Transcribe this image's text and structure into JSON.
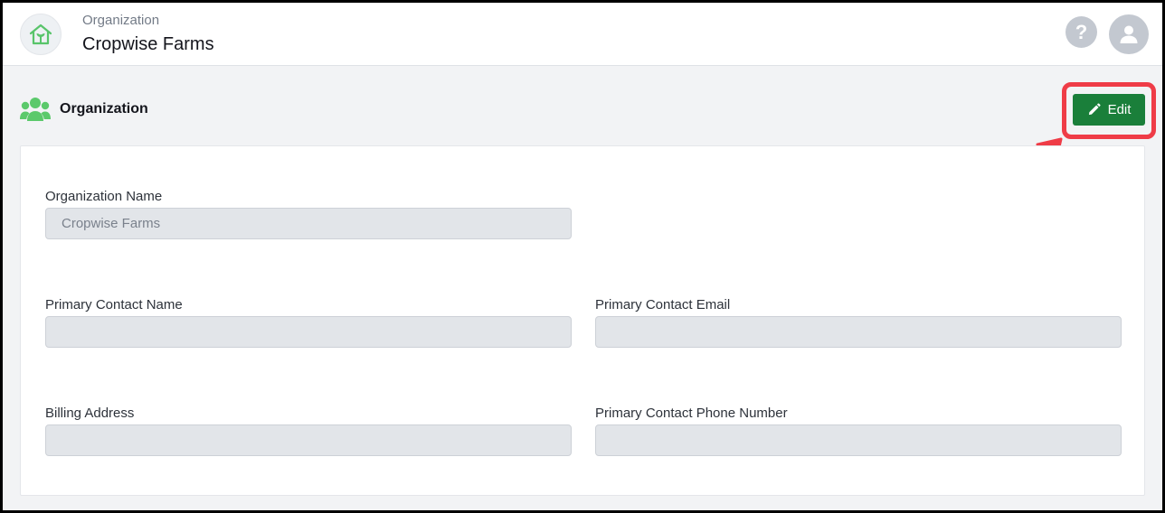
{
  "header": {
    "org_label": "Organization",
    "org_name": "Cropwise Farms",
    "help_symbol": "?"
  },
  "section": {
    "title": "Organization",
    "icon": "users-icon",
    "edit_label": "Edit"
  },
  "form": {
    "organization_name": {
      "label": "Organization Name",
      "value": "Cropwise Farms"
    },
    "primary_contact_name": {
      "label": "Primary Contact Name",
      "value": ""
    },
    "primary_contact_email": {
      "label": "Primary Contact Email",
      "value": ""
    },
    "billing_address": {
      "label": "Billing Address",
      "value": ""
    },
    "primary_contact_phone": {
      "label": "Primary Contact Phone Number",
      "value": ""
    }
  },
  "colors": {
    "accent_green": "#1a7f3a",
    "icon_green": "#5bc96b",
    "highlight_red": "#ef3c47"
  }
}
